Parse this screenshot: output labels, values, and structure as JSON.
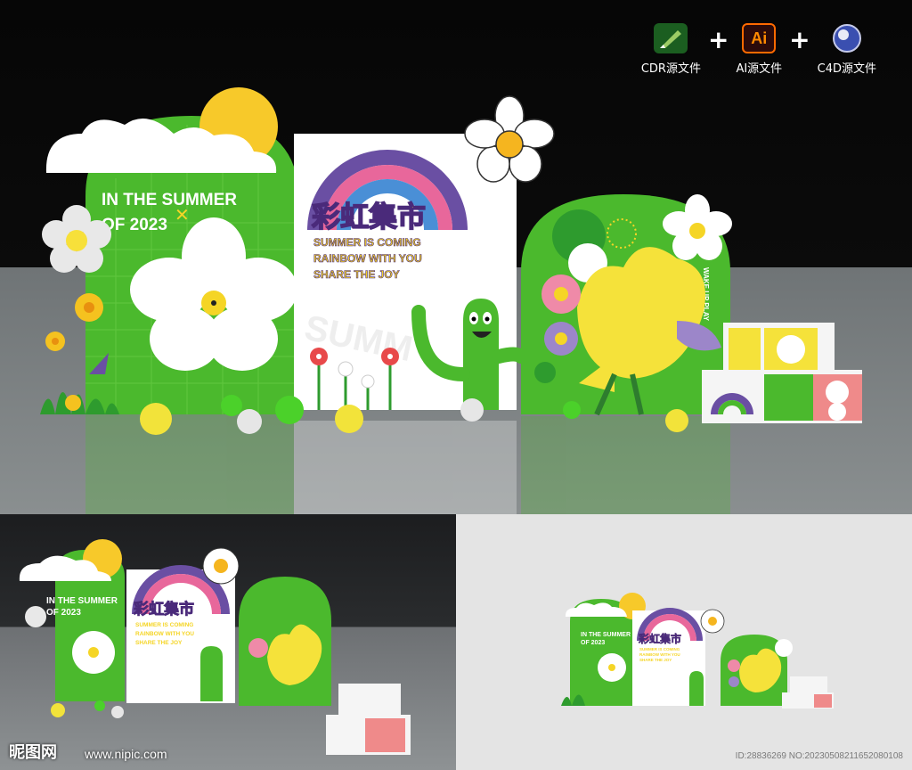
{
  "formats": [
    {
      "icon": "coreldraw-icon",
      "label": "CDR源文件",
      "color": "#2e7d32"
    },
    {
      "icon": "illustrator-icon",
      "label": "AI源文件",
      "glyph": "Ai",
      "color": "#330000"
    },
    {
      "icon": "cinema4d-icon",
      "label": "C4D源文件",
      "color": "#1a237e"
    }
  ],
  "plus": "+",
  "display": {
    "left_panel_line1": "IN THE SUMMER",
    "left_panel_line2": "OF 2023",
    "main_title": "彩虹集市",
    "slogan1": "SUMMER IS COMING",
    "slogan2": "RAINBOW WITH YOU",
    "slogan3": "SHARE THE JOY",
    "reflection_text": "SUMM",
    "side_text": "WAKE UP PLAY"
  },
  "watermark": {
    "logo": "昵图网",
    "url": "www.nipic.com",
    "id": "ID:28836269 NO:20230508211652080108"
  },
  "colors": {
    "green": "#4bb92d",
    "white": "#ffffff",
    "yellow": "#f5d526",
    "purple": "#6a4fa3",
    "pink": "#e8679b",
    "blue": "#4a8fd6"
  }
}
